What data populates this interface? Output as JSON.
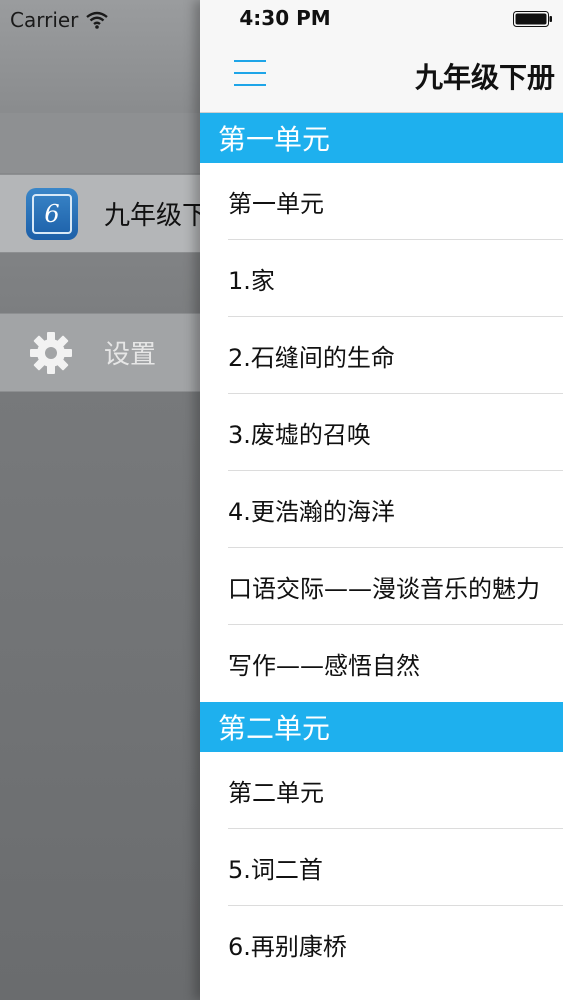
{
  "status_bar": {
    "carrier": "Carrier",
    "time": "4:30 PM"
  },
  "drawer": {
    "items": [
      {
        "label": "九年级下册",
        "icon": "book-app-icon"
      },
      {
        "label": "设置",
        "icon": "gear-icon"
      }
    ]
  },
  "navbar": {
    "title": "九年级下册",
    "menu_icon": "hamburger-icon",
    "accent_color": "#1ea5e8"
  },
  "sections": [
    {
      "header": "第一单元",
      "rows": [
        "第一单元",
        "1.家",
        "2.石缝间的生命",
        "3.废墟的召唤",
        "4.更浩瀚的海洋",
        "口语交际——漫谈音乐的魅力",
        "写作——感悟自然"
      ]
    },
    {
      "header": "第二单元",
      "rows": [
        "第二单元",
        "5.词二首",
        "6.再别康桥"
      ]
    }
  ],
  "colors": {
    "section_header": "#1eb0ee",
    "drawer_dim": "#6e7072"
  }
}
